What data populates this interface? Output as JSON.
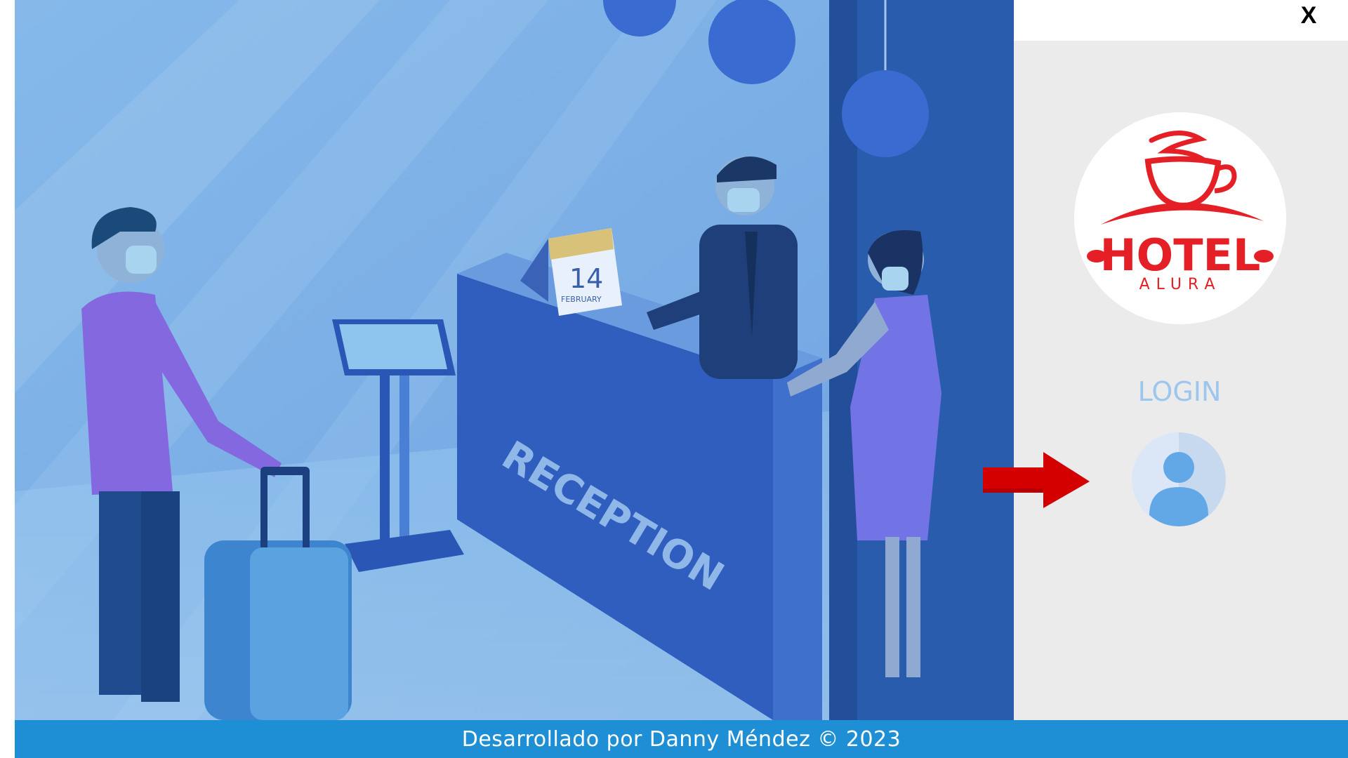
{
  "window": {
    "close_label": "X"
  },
  "illustration": {
    "calendar_day": "14",
    "calendar_month": "FEBRUARY",
    "desk_sign": "RECEPTION"
  },
  "logo": {
    "brand_main": "HOTEL",
    "brand_sub": "ALURA"
  },
  "login": {
    "title": "LOGIN"
  },
  "footer": {
    "text": "Desarrollado por Danny Méndez © 2023"
  },
  "colors": {
    "footer_bg": "#1e8fd4",
    "panel_bg": "#ebebeb",
    "login_title": "#9dc6ef",
    "logo_red": "#e42026",
    "arrow_red": "#d40000"
  },
  "icons": {
    "close": "close-icon",
    "avatar": "user-avatar-icon",
    "arrow": "arrow-right-icon",
    "logo": "hotel-alura-logo"
  }
}
